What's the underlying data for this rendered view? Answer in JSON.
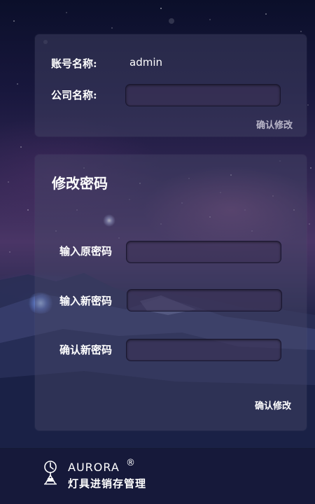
{
  "account_form": {
    "account_label": "账号名称:",
    "account_value": "admin",
    "company_label": "公司名称:",
    "company_value": "",
    "confirm_label": "确认修改"
  },
  "password_form": {
    "title": "修改密码",
    "old_password_label": "输入原密码",
    "new_password_label": "输入新密码",
    "confirm_password_label": "确认新密码",
    "old_password_value": "",
    "new_password_value": "",
    "confirm_password_value": "",
    "confirm_label": "确认修改"
  },
  "footer": {
    "brand_name": "AURORA",
    "registered_mark": "®",
    "brand_subtitle": "灯具进销存管理",
    "logo_icon": "lamp-clock-icon"
  },
  "colors": {
    "card_background": "#464669",
    "account_confirm_text": "#b9b6c8",
    "password_confirm_text": "#ffffff",
    "footer_background": "#16193a"
  }
}
